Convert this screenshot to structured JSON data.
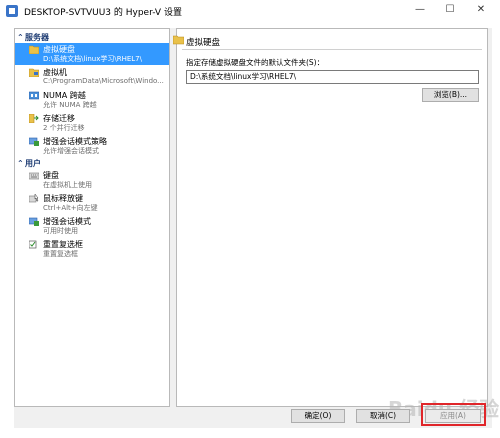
{
  "window": {
    "title": "DESKTOP-SVTVUU3 的 Hyper-V 设置",
    "minimize": "—",
    "maximize": "☐",
    "close": "✕"
  },
  "sidebar": {
    "section_server": "服务器",
    "section_user": "用户",
    "server_items": [
      {
        "name": "虚拟硬盘",
        "detail": "D:\\系统文档\\linux学习\\RHEL7\\"
      },
      {
        "name": "虚拟机",
        "detail": "C:\\ProgramData\\Microsoft\\Windo..."
      },
      {
        "name": "NUMA 跨越",
        "detail": "允许 NUMA 跨越"
      },
      {
        "name": "存储迁移",
        "detail": "2 个并行迁移"
      },
      {
        "name": "增强会话模式策略",
        "detail": "允许增强会话模式"
      }
    ],
    "user_items": [
      {
        "name": "键盘",
        "detail": "在虚拟机上使用"
      },
      {
        "name": "鼠标释放键",
        "detail": "Ctrl+Alt+向左键"
      },
      {
        "name": "增强会话模式",
        "detail": "可用时使用"
      },
      {
        "name": "重置复选框",
        "detail": "重置复选框"
      }
    ]
  },
  "main": {
    "title": "虚拟硬盘",
    "folder_label": "指定存储虚拟硬盘文件的默认文件夹(S)：",
    "folder_value": "D:\\系统文档\\linux学习\\RHEL7\\",
    "browse_label": "浏览(B)..."
  },
  "footer": {
    "ok_label": "确定(O)",
    "cancel_label": "取消(C)",
    "apply_label": "应用(A)"
  },
  "watermark": "Baidu 经验",
  "colors": {
    "selection": "#3399ff",
    "section_header": "#1f3d74",
    "highlight_box": "#e0262a"
  }
}
